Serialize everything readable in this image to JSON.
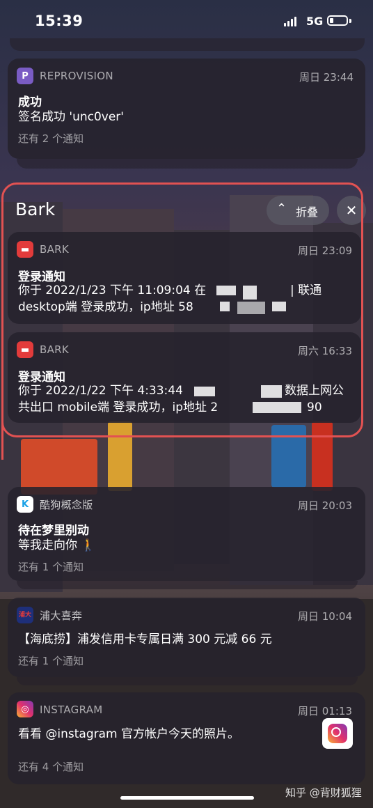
{
  "status_bar": {
    "time": "15:39",
    "network": "5G"
  },
  "notifications": [
    {
      "app": "REPROVISION",
      "time": "周日 23:44",
      "title": "成功",
      "body": [
        "签名成功 'unc0ver'"
      ],
      "more": "还有 2 个通知"
    },
    {
      "app": "BARK",
      "time": "周日 23:09",
      "title": "登录通知",
      "body": [
        "你于 2022/1/23 下午 11:09:04 在",
        "| 联通",
        "desktop端 登录成功，ip地址  58"
      ]
    },
    {
      "app": "BARK",
      "time": "周六 16:33",
      "title": "登录通知",
      "body": [
        "你于 2022/1/22 下午 4:33:44",
        "数据上网公",
        "共出口 mobile端 登录成功，ip地址  2",
        "90"
      ]
    },
    {
      "app": "酷狗概念版",
      "time": "周日 20:03",
      "title": "待在梦里别动",
      "body": [
        "等我走向你 🚶"
      ],
      "more": "还有 1 个通知"
    },
    {
      "app": "浦大喜奔",
      "time": "周日 10:04",
      "body": [
        "【海底捞】浦发信用卡专属日满 300 元减 66 元"
      ],
      "more": "还有 1 个通知"
    },
    {
      "app": "INSTAGRAM",
      "time": "周日 01:13",
      "body": [
        "看看 @instagram 官方帐户今天的照片。"
      ],
      "more": "还有 4 个通知"
    }
  ],
  "group": {
    "title": "Bark",
    "collapse_label": "折叠",
    "close_symbol": "✕",
    "collapse_symbol": "⌃"
  },
  "icons": {
    "reprovision": "reprovision-icon",
    "bark": "bark-icon",
    "kugou": "kugou-icon",
    "spdb": "spdb-icon",
    "instagram": "instagram-icon"
  },
  "watermark": "知乎 @背财狐狸",
  "colors": {
    "highlight": "#e25252",
    "bark_red": "#e23b3b",
    "kugou_blue": "#1aa1e6",
    "reprovision_purple": "#7a5cc4"
  }
}
